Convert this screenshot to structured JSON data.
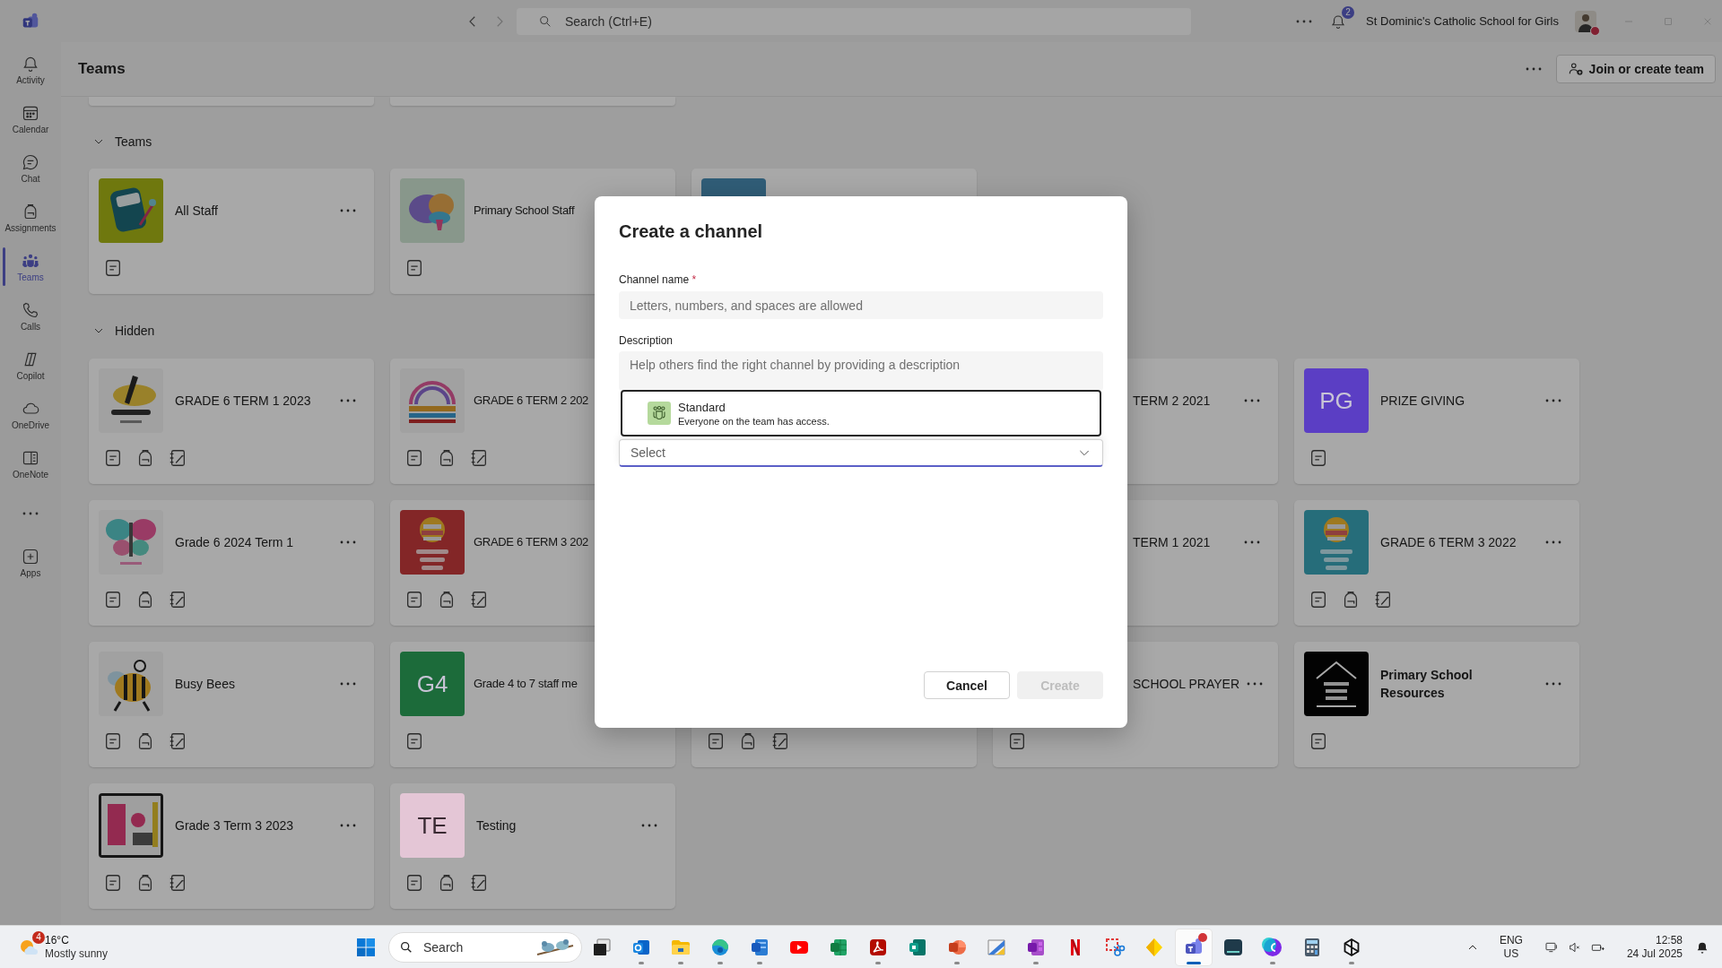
{
  "title_bar": {
    "search": {
      "placeholder": "Search (Ctrl+E)"
    },
    "notifications": {
      "badge": "2"
    },
    "organization": "St Dominic's Catholic School for Girls"
  },
  "rail": [
    {
      "label": "Activity",
      "kind": "activity",
      "selected": false
    },
    {
      "label": "Calendar",
      "kind": "calendar",
      "selected": false
    },
    {
      "label": "Chat",
      "kind": "chat",
      "selected": false
    },
    {
      "label": "Assignments",
      "kind": "assignments",
      "selected": false
    },
    {
      "label": "Teams",
      "kind": "teams",
      "selected": true
    },
    {
      "label": "Calls",
      "kind": "calls",
      "selected": false
    },
    {
      "label": "Copilot",
      "kind": "copilot",
      "selected": false
    },
    {
      "label": "OneDrive",
      "kind": "onedrive",
      "selected": false
    },
    {
      "label": "OneNote",
      "kind": "onenote",
      "selected": false
    },
    {
      "kind": "more",
      "selected": false
    },
    {
      "label": "Apps",
      "kind": "apps",
      "selected": false
    }
  ],
  "header": {
    "title": "Teams",
    "action": "Join or create team"
  },
  "partial_row": [
    {
      "kind": "card-edge"
    },
    {
      "kind": "card-edge"
    }
  ],
  "sections": [
    {
      "title": "Teams",
      "expanded": true,
      "rows": [
        [
          {
            "kind": "full",
            "title": "All Staff",
            "unread": false,
            "image": {
              "kind": "picture"
            },
            "icons": [
              {
                "kind": "posts"
              }
            ]
          },
          {
            "kind": "cut-right",
            "title": "Primary School Staff",
            "unread": false,
            "image": {
              "kind": "picture"
            },
            "icons": [
              {
                "kind": "posts"
              }
            ]
          },
          {
            "kind": "image-top",
            "image": {
              "kind": "picture"
            }
          }
        ]
      ]
    },
    {
      "title": "Hidden",
      "expanded": true,
      "rows": [
        [
          {
            "kind": "full",
            "title": "GRADE 6 TERM 1 2023",
            "unread": false,
            "image": {
              "kind": "picture"
            },
            "icons": [
              {
                "kind": "posts"
              },
              {
                "kind": "assignments"
              },
              {
                "kind": "notebook"
              }
            ]
          },
          {
            "kind": "cut-right",
            "title": "GRADE 6 TERM 2 202",
            "unread": false,
            "image": {
              "kind": "picture"
            },
            "icons": [
              {
                "kind": "posts"
              },
              {
                "kind": "assignments"
              },
              {
                "kind": "notebook"
              }
            ]
          },
          {
            "kind": "hidden"
          },
          {
            "kind": "cut-left",
            "title": "TERM 2 2021",
            "unread": false
          },
          {
            "kind": "full",
            "title": "PRIZE GIVING",
            "unread": false,
            "image": {
              "kind": "initials",
              "text": "PG",
              "color": "#5b3ec4"
            },
            "icons": [
              {
                "kind": "posts"
              }
            ]
          }
        ],
        [
          {
            "kind": "full",
            "title": "Grade 6 2024 Term 1",
            "unread": false,
            "image": {
              "kind": "picture"
            },
            "icons": [
              {
                "kind": "posts"
              },
              {
                "kind": "assignments"
              },
              {
                "kind": "notebook"
              }
            ]
          },
          {
            "kind": "cut-right",
            "title": "GRADE 6 TERM 3 202",
            "unread": false,
            "image": {
              "kind": "picture"
            },
            "icons": [
              {
                "kind": "posts"
              },
              {
                "kind": "assignments"
              },
              {
                "kind": "notebook"
              }
            ]
          },
          {
            "kind": "hidden"
          },
          {
            "kind": "cut-left",
            "title": "TERM 1 2021",
            "unread": false
          },
          {
            "kind": "full",
            "title": "GRADE 6 TERM 3 2022",
            "unread": false,
            "image": {
              "kind": "picture"
            },
            "icons": [
              {
                "kind": "posts"
              },
              {
                "kind": "assignments"
              },
              {
                "kind": "notebook"
              }
            ]
          }
        ],
        [
          {
            "kind": "full",
            "title": "Busy Bees",
            "unread": false,
            "image": {
              "kind": "picture"
            },
            "icons": [
              {
                "kind": "posts"
              },
              {
                "kind": "assignments"
              },
              {
                "kind": "notebook"
              }
            ]
          },
          {
            "kind": "cut-right",
            "title": "Grade 4 to 7 staff me",
            "unread": false,
            "image": {
              "kind": "initials",
              "text": "G4",
              "color": "#1c6b3a"
            },
            "icons": [
              {
                "kind": "posts"
              }
            ]
          },
          {
            "kind": "icons-only",
            "icons": [
              {
                "kind": "posts"
              },
              {
                "kind": "assignments"
              },
              {
                "kind": "notebook"
              }
            ]
          },
          {
            "kind": "cut-left",
            "title": "SCHOOL PRAYER",
            "unread": false,
            "icons": [
              {
                "kind": "posts"
              }
            ]
          },
          {
            "kind": "full",
            "title": "Primary School Resources",
            "unread": true,
            "image": {
              "kind": "picture"
            },
            "icons": [
              {
                "kind": "posts"
              }
            ]
          }
        ],
        [
          {
            "kind": "full",
            "title": "Grade 3 Term 3 2023",
            "unread": false,
            "image": {
              "kind": "picture"
            },
            "icons": [
              {
                "kind": "posts"
              },
              {
                "kind": "assignments"
              },
              {
                "kind": "notebook"
              }
            ]
          },
          {
            "kind": "full",
            "title": "Testing",
            "unread": false,
            "image": {
              "kind": "initials",
              "text": "TE",
              "color": "#e4c6d6"
            },
            "icons": [
              {
                "kind": "posts"
              },
              {
                "kind": "assignments"
              },
              {
                "kind": "notebook"
              }
            ]
          }
        ]
      ]
    }
  ],
  "dialog": {
    "title": "Create a channel",
    "name_field": {
      "label": "Channel name",
      "required_mark": "*",
      "placeholder": "Letters, numbers, and spaces are allowed"
    },
    "description_field": {
      "label": "Description",
      "placeholder": "Help others find the right channel by providing a description"
    },
    "type_select": {
      "placeholder": "Select",
      "expanded": true,
      "options": [
        {
          "label": "Standard",
          "description": "Everyone on the team has access.",
          "focused": true
        }
      ]
    },
    "buttons": [
      {
        "label": "Cancel",
        "disabled": false
      },
      {
        "label": "Create",
        "disabled": true
      }
    ]
  },
  "taskbar": {
    "weather": {
      "badge": "4",
      "temperature": "16°C",
      "condition": "Mostly sunny"
    },
    "search": {
      "placeholder": "Search"
    },
    "apps": [
      {
        "kind": "taskview",
        "running": false,
        "active": false
      },
      {
        "kind": "outlook",
        "running": true,
        "active": false
      },
      {
        "kind": "explorer",
        "running": true,
        "active": false
      },
      {
        "kind": "edge",
        "running": true,
        "active": false
      },
      {
        "kind": "word",
        "running": true,
        "active": false
      },
      {
        "kind": "youtube",
        "running": false,
        "active": false
      },
      {
        "kind": "excel",
        "running": false,
        "active": false
      },
      {
        "kind": "acrobat",
        "running": true,
        "active": false
      },
      {
        "kind": "publisher",
        "running": false,
        "active": false
      },
      {
        "kind": "powerpoint",
        "running": true,
        "active": false
      },
      {
        "kind": "viewer",
        "running": false,
        "active": false
      },
      {
        "kind": "onenote",
        "running": true,
        "active": false
      },
      {
        "kind": "netflix",
        "running": false,
        "active": false
      },
      {
        "kind": "snipping",
        "running": false,
        "active": false
      },
      {
        "kind": "diamond",
        "running": false,
        "active": false
      },
      {
        "kind": "teams",
        "running": true,
        "active": true
      },
      {
        "kind": "cs",
        "running": false,
        "active": false
      },
      {
        "kind": "canva",
        "running": true,
        "active": false
      },
      {
        "kind": "calculator",
        "running": false,
        "active": false
      },
      {
        "kind": "chatgpt",
        "running": true,
        "active": false
      }
    ],
    "tray": {
      "language": "ENG",
      "region": "US",
      "time": "12:58",
      "date": "24 Jul 2025"
    }
  }
}
